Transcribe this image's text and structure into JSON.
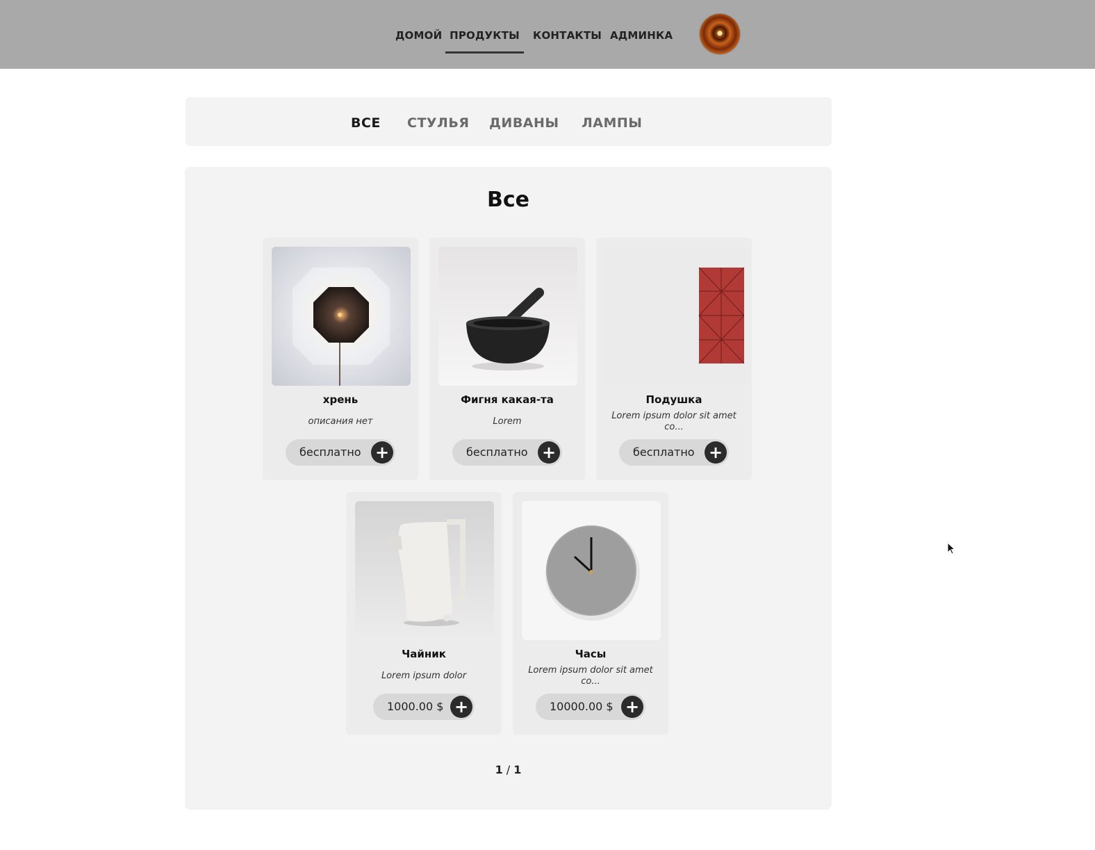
{
  "nav": {
    "items": [
      {
        "label": "ДОМОЙ"
      },
      {
        "label": "ПРОДУКТЫ"
      },
      {
        "label": "КОНТАКТЫ"
      },
      {
        "label": "АДМИНКА"
      }
    ],
    "active": "ПРОДУКТЫ"
  },
  "categories": {
    "tabs": [
      {
        "label": "ВСЕ"
      },
      {
        "label": "СТУЛЬЯ"
      },
      {
        "label": "ДИВАНЫ"
      },
      {
        "label": "ЛАМПЫ"
      }
    ],
    "active": "ВСЕ"
  },
  "section": {
    "title": "Все"
  },
  "products": [
    {
      "name": "хрень",
      "description": "описания нет",
      "price": "бесплатно",
      "image": "wall-lamp-image"
    },
    {
      "name": "Фигня какая-та",
      "description": "Lorem",
      "price": "бесплатно",
      "image": "mortar-pestle-image"
    },
    {
      "name": "Подушка",
      "description": "Lorem ipsum dolor sit amet co...",
      "price": "бесплатно",
      "image": "cushion-image"
    },
    {
      "name": "Чайник",
      "description": "Lorem ipsum dolor",
      "price": "1000.00 $",
      "image": "pitcher-image"
    },
    {
      "name": "Часы",
      "description": "Lorem ipsum dolor sit amet co...",
      "price": "10000.00 $",
      "image": "wall-clock-image"
    }
  ],
  "add_icon": "+",
  "pager": {
    "current": "1",
    "separator": "/",
    "total": "1"
  },
  "colors": {
    "header_bg": "#a9a9a9",
    "panel_bg": "#f3f3f3",
    "add_button": "#2b2b2b"
  }
}
